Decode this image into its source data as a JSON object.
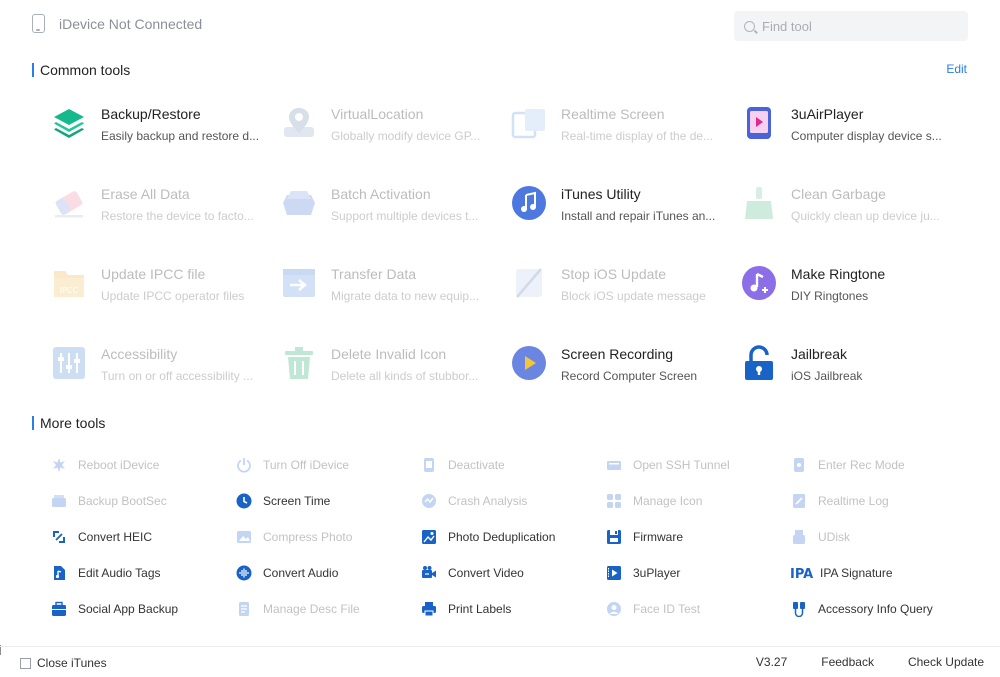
{
  "header": {
    "device_status": "iDevice Not Connected",
    "search_placeholder": "Find tool"
  },
  "common_tools": {
    "title": "Common tools",
    "edit_label": "Edit",
    "rows": [
      [
        {
          "title": "Backup/Restore",
          "desc": "Easily backup and restore d...",
          "icon": "layers-icon",
          "enabled": true
        },
        {
          "title": "VirtualLocation",
          "desc": "Globally modify device GP...",
          "icon": "map-pin-icon",
          "enabled": false
        },
        {
          "title": "Realtime Screen",
          "desc": "Real-time display of the de...",
          "icon": "screen-mirror-icon",
          "enabled": false
        },
        {
          "title": "3uAirPlayer",
          "desc": "Computer display device s...",
          "icon": "airplayer-icon",
          "enabled": true
        }
      ],
      [
        {
          "title": "Erase All Data",
          "desc": "Restore the device to facto...",
          "icon": "eraser-icon",
          "enabled": false
        },
        {
          "title": "Batch Activation",
          "desc": "Support multiple devices t...",
          "icon": "activation-icon",
          "enabled": false
        },
        {
          "title": "iTunes Utility",
          "desc": "Install and repair iTunes an...",
          "icon": "itunes-icon",
          "enabled": true
        },
        {
          "title": "Clean Garbage",
          "desc": "Quickly clean up device ju...",
          "icon": "broom-icon",
          "enabled": false
        }
      ],
      [
        {
          "title": "Update IPCC file",
          "desc": "Update IPCC operator files",
          "icon": "ipcc-folder-icon",
          "enabled": false
        },
        {
          "title": "Transfer Data",
          "desc": "Migrate data to new equip...",
          "icon": "transfer-icon",
          "enabled": false
        },
        {
          "title": "Stop iOS Update",
          "desc": "Block iOS update message",
          "icon": "stop-update-icon",
          "enabled": false
        },
        {
          "title": "Make Ringtone",
          "desc": "DIY Ringtones",
          "icon": "ringtone-icon",
          "enabled": true
        }
      ],
      [
        {
          "title": "Accessibility",
          "desc": "Turn on or off accessibility ...",
          "icon": "sliders-icon",
          "enabled": false
        },
        {
          "title": "Delete Invalid Icon",
          "desc": "Delete all kinds of stubbor...",
          "icon": "trash-icon",
          "enabled": false
        },
        {
          "title": "Screen Recording",
          "desc": "Record Computer Screen",
          "icon": "screen-recording-icon",
          "enabled": true
        },
        {
          "title": "Jailbreak",
          "desc": "iOS Jailbreak",
          "icon": "unlock-icon",
          "enabled": true
        }
      ]
    ]
  },
  "more_tools": {
    "title": "More tools",
    "rows": [
      [
        {
          "label": "Reboot iDevice",
          "icon": "reboot-icon",
          "enabled": false
        },
        {
          "label": "Turn Off iDevice",
          "icon": "power-icon",
          "enabled": false
        },
        {
          "label": "Deactivate",
          "icon": "deactivate-icon",
          "enabled": false
        },
        {
          "label": "Open SSH Tunnel",
          "icon": "ssh-icon",
          "enabled": false
        },
        {
          "label": "Enter Rec Mode",
          "icon": "rec-mode-icon",
          "enabled": false
        }
      ],
      [
        {
          "label": "Backup BootSec",
          "icon": "bootsec-icon",
          "enabled": false
        },
        {
          "label": "Screen Time",
          "icon": "clock-icon",
          "enabled": true
        },
        {
          "label": "Crash Analysis",
          "icon": "crash-icon",
          "enabled": false
        },
        {
          "label": "Manage Icon",
          "icon": "grid-icon",
          "enabled": false
        },
        {
          "label": "Realtime Log",
          "icon": "log-icon",
          "enabled": false
        }
      ],
      [
        {
          "label": "Convert HEIC",
          "icon": "convert-icon",
          "enabled": true
        },
        {
          "label": "Compress Photo",
          "icon": "photo-icon",
          "enabled": false
        },
        {
          "label": "Photo Deduplication",
          "icon": "photo-dedup-icon",
          "enabled": true
        },
        {
          "label": "Firmware",
          "icon": "firmware-icon",
          "enabled": true
        },
        {
          "label": "UDisk",
          "icon": "udisk-icon",
          "enabled": false
        }
      ],
      [
        {
          "label": "Edit Audio Tags",
          "icon": "audio-file-icon",
          "enabled": true
        },
        {
          "label": "Convert Audio",
          "icon": "audio-wave-icon",
          "enabled": true
        },
        {
          "label": "Convert Video",
          "icon": "video-camera-icon",
          "enabled": true
        },
        {
          "label": "3uPlayer",
          "icon": "player-icon",
          "enabled": true
        },
        {
          "label": "IPA Signature",
          "icon": "ipa-icon",
          "enabled": true
        }
      ],
      [
        {
          "label": "Social App Backup",
          "icon": "briefcase-icon",
          "enabled": true
        },
        {
          "label": "Manage Desc File",
          "icon": "desc-file-icon",
          "enabled": false
        },
        {
          "label": "Print Labels",
          "icon": "printer-icon",
          "enabled": true
        },
        {
          "label": "Face ID Test",
          "icon": "face-id-icon",
          "enabled": false
        },
        {
          "label": "Accessory Info Query",
          "icon": "accessory-icon",
          "enabled": true
        }
      ]
    ]
  },
  "footer": {
    "close_itunes_label": "Close iTunes",
    "version": "V3.27",
    "feedback_label": "Feedback",
    "check_update_label": "Check Update"
  },
  "colors": {
    "accent": "#2b7de9",
    "icon_blue": "#1a63c6"
  }
}
